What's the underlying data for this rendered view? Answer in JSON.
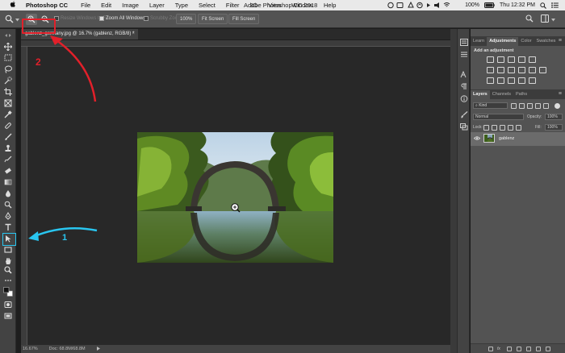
{
  "menubar": {
    "apple": "",
    "app": "Photoshop CC",
    "items": [
      "File",
      "Edit",
      "Image",
      "Layer",
      "Type",
      "Select",
      "Filter",
      "3D",
      "View",
      "Window",
      "Help"
    ],
    "window_title": "Adobe Photoshop CC 2018",
    "battery": "100%",
    "clock": "Thu 12:32 PM"
  },
  "options_bar": {
    "resize_windows_label": "Resize Windows to Fit",
    "zoom_all_windows_label": "Zoom All Windows",
    "scrubby_zoom_label": "Scrubby Zoom",
    "zoom_100_label": "100%",
    "fit_screen_label": "Fit Screen",
    "fill_screen_label": "Fill Screen"
  },
  "document": {
    "tab_title": "gablenz_germany.jpg @ 16.7% (gablenz, RGB/8) *",
    "tab_close": "×",
    "zoom_status": "16.67%",
    "doc_size": "Doc: 68.8M/68.8M"
  },
  "annotations": {
    "label_1": "1",
    "label_2": "2",
    "color_1": "#29c6f0",
    "color_2": "#e2202a"
  },
  "panels": {
    "top_tabs": [
      "Learn",
      "Adjustments",
      "Color",
      "Swatches"
    ],
    "top_active": "Adjustments",
    "add_adjustment": "Add an adjustment",
    "layer_tabs": [
      "Layers",
      "Channels",
      "Paths"
    ],
    "layer_active": "Layers",
    "kind_label": "Kind",
    "blend_mode": "Normal",
    "opacity_label": "Opacity:",
    "opacity_value": "100%",
    "lock_label": "Lock:",
    "fill_label": "Fill:",
    "fill_value": "100%",
    "layer_name": "gablenz",
    "footer_fx": "fx",
    "menu_glyph": "≡"
  },
  "icons": [
    "zoom-in-icon",
    "zoom-out-icon",
    "zoom-tool-icon",
    "search-icon",
    "workspace-icon",
    "wifi-icon",
    "battery-icon",
    "eye-icon"
  ]
}
